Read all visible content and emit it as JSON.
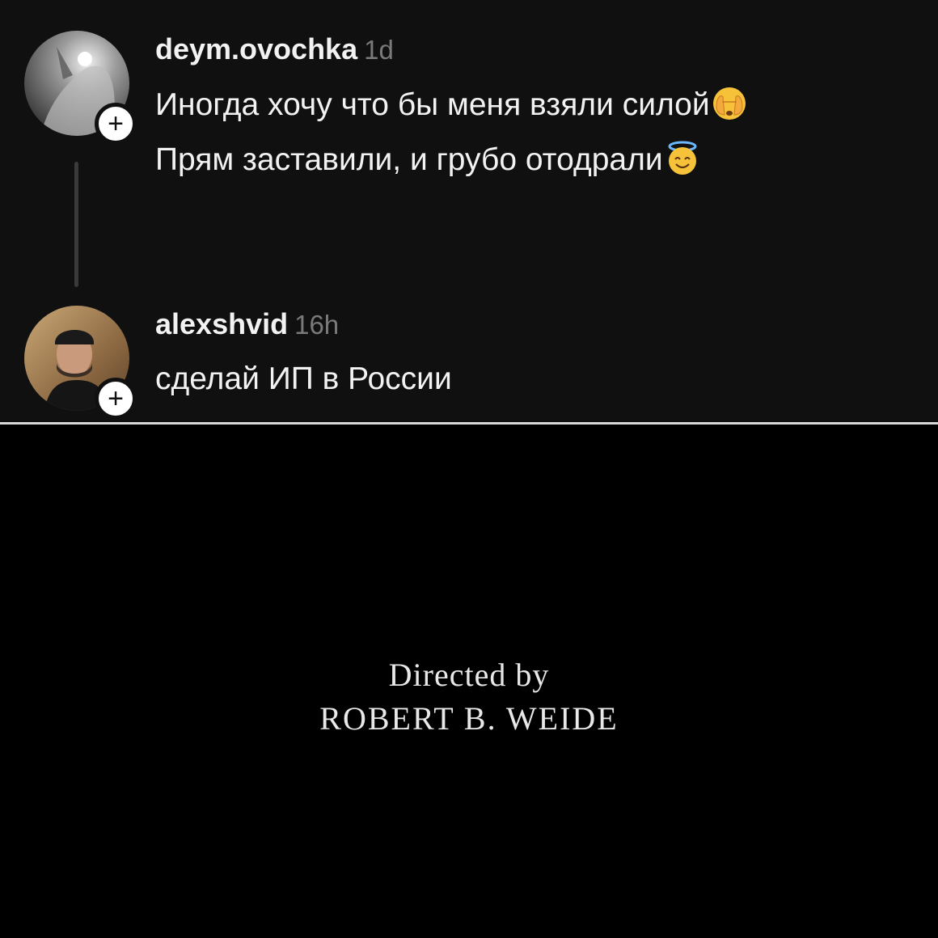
{
  "comments": [
    {
      "username": "deym.ovochka",
      "time": "1d",
      "lines": [
        {
          "text": "Иногда хочу что бы меня взяли силой",
          "emoji": "face-with-hand-over-eyes-emoji"
        },
        {
          "text": "Прям заставили, и грубо отодрали",
          "emoji": "smiling-face-with-halo-emoji"
        }
      ],
      "follow_label": "+"
    },
    {
      "username": "alexshvid",
      "time": "16h",
      "lines": [
        {
          "text": "сделай ИП в России"
        }
      ],
      "follow_label": "+"
    }
  ],
  "credits": {
    "line1": "Directed by",
    "line2": "ROBERT B. WEIDE"
  },
  "colors": {
    "thread_background": "#101010",
    "credits_background": "#000000",
    "text": "#f2f2f2",
    "timestamp": "#7a7a7a"
  }
}
